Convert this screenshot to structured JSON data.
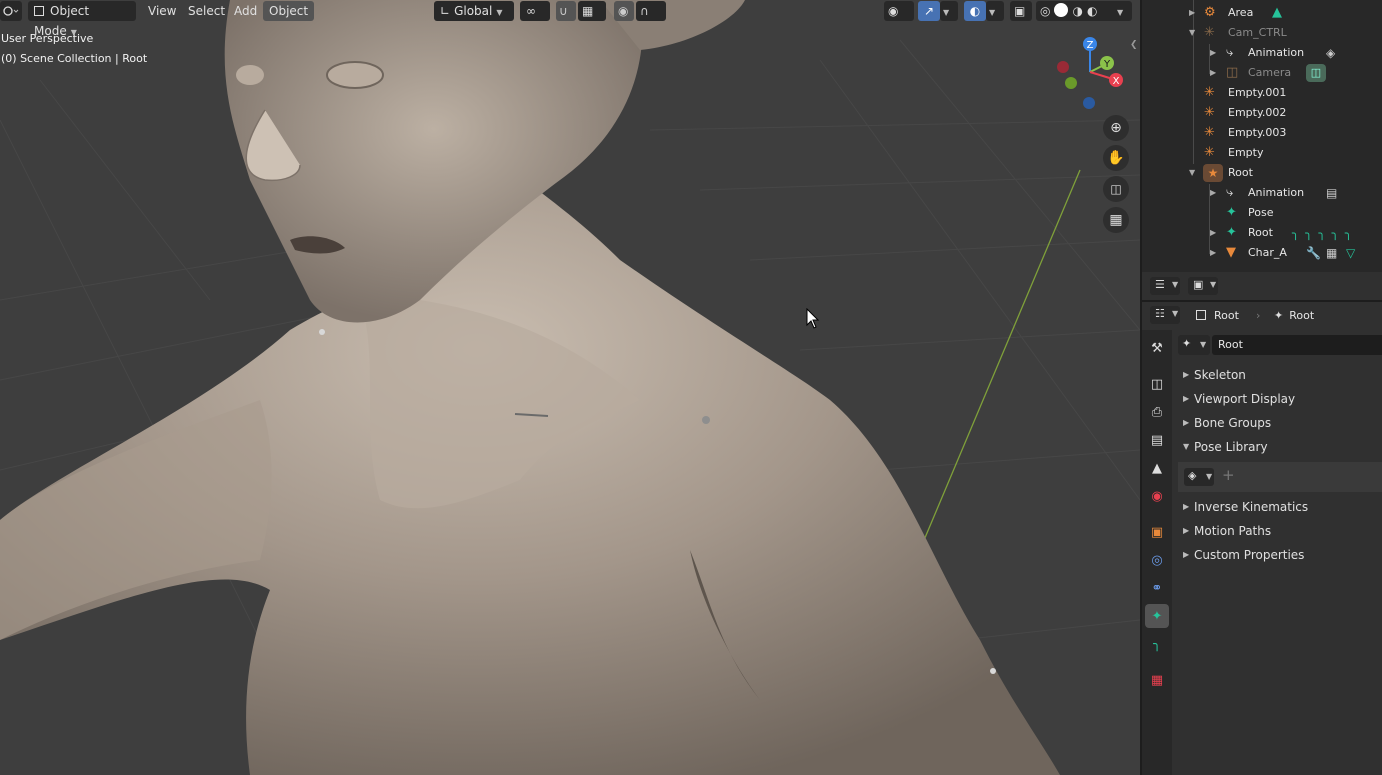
{
  "header": {
    "mode": "Object Mode",
    "menus": [
      "View",
      "Select",
      "Add",
      "Object"
    ],
    "orientation": "Global"
  },
  "viewport": {
    "perspective_label": "User Perspective",
    "collection_label": "(0) Scene Collection | Root",
    "gizmo_axes": {
      "z": "Z",
      "y": "Y",
      "x": "X"
    }
  },
  "outliner": {
    "rows": [
      {
        "label": "Area",
        "icon": "light-icon"
      },
      {
        "label": "Cam_CTRL",
        "icon": "empty-icon"
      },
      {
        "label": "Animation",
        "icon": "animation-icon"
      },
      {
        "label": "Camera",
        "icon": "camera-icon"
      },
      {
        "label": "Empty.001",
        "icon": "empty-icon"
      },
      {
        "label": "Empty.002",
        "icon": "empty-icon"
      },
      {
        "label": "Empty.003",
        "icon": "empty-icon"
      },
      {
        "label": "Empty",
        "icon": "empty-icon"
      },
      {
        "label": "Root",
        "icon": "armature-icon"
      },
      {
        "label": "Animation",
        "icon": "animation-icon"
      },
      {
        "label": "Pose",
        "icon": "pose-icon"
      },
      {
        "label": "Root",
        "icon": "armature-data-icon"
      },
      {
        "label": "Char_A",
        "icon": "mesh-icon"
      }
    ]
  },
  "properties": {
    "breadcrumb_object": "Root",
    "breadcrumb_data": "Root",
    "data_name": "Root",
    "panels": [
      {
        "label": "Skeleton",
        "open": false
      },
      {
        "label": "Viewport Display",
        "open": false
      },
      {
        "label": "Bone Groups",
        "open": false
      },
      {
        "label": "Pose Library",
        "open": true
      },
      {
        "label": "Inverse Kinematics",
        "open": false
      },
      {
        "label": "Motion Paths",
        "open": false
      },
      {
        "label": "Custom Properties",
        "open": false
      }
    ],
    "pose_library_add": "+"
  },
  "colors": {
    "accent_orange": "#e8893b",
    "armature_green": "#26c39a",
    "axis_x": "#e8404f",
    "axis_y": "#8bc34a",
    "axis_z": "#3a86e8"
  }
}
